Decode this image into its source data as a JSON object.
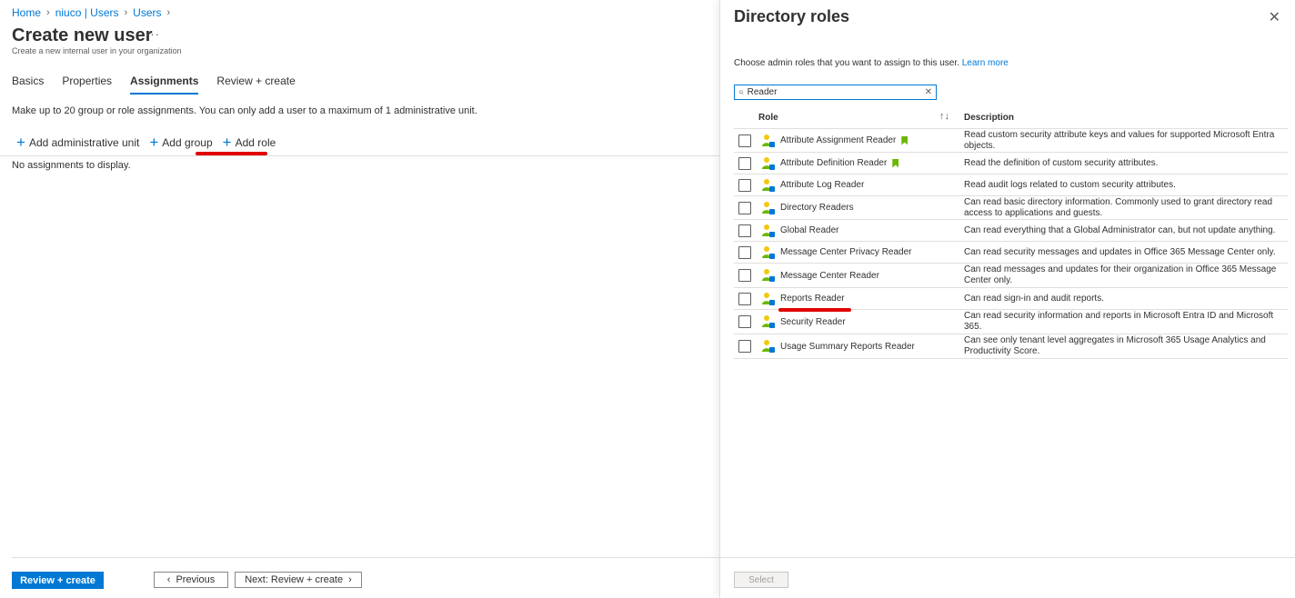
{
  "breadcrumb": [
    {
      "label": "Home"
    },
    {
      "label": "niuco | Users"
    },
    {
      "label": "Users"
    }
  ],
  "page": {
    "title": "Create new user",
    "more": "···",
    "subtitle": "Create a new internal user in your organization"
  },
  "tabs": [
    {
      "label": "Basics",
      "active": false
    },
    {
      "label": "Properties",
      "active": false
    },
    {
      "label": "Assignments",
      "active": true
    },
    {
      "label": "Review + create",
      "active": false
    }
  ],
  "info_text": "Make up to 20 group or role assignments. You can only add a user to a maximum of 1 administrative unit.",
  "toolbar": {
    "add_admin_unit": "Add administrative unit",
    "add_group": "Add group",
    "add_role": "Add role"
  },
  "no_assignments": "No assignments to display.",
  "footer": {
    "review_create": "Review + create",
    "previous": "Previous",
    "next": "Next: Review + create"
  },
  "panel": {
    "title": "Directory roles",
    "description": "Choose admin roles that you want to assign to this user.",
    "learn_more": "Learn more",
    "search_value": "Reader",
    "col_role": "Role",
    "col_description": "Description",
    "select_label": "Select",
    "roles": [
      {
        "name": "Attribute Assignment Reader",
        "bookmark": true,
        "description": "Read custom security attribute keys and values for supported Microsoft Entra objects.",
        "h": 26
      },
      {
        "name": "Attribute Definition Reader",
        "bookmark": true,
        "description": "Read the definition of custom security attributes.",
        "h": 24
      },
      {
        "name": "Attribute Log Reader",
        "bookmark": false,
        "description": "Read audit logs related to custom security attributes.",
        "h": 24
      },
      {
        "name": "Directory Readers",
        "bookmark": false,
        "description": "Can read basic directory information. Commonly used to grant directory read access to applications and guests.",
        "h": 26
      },
      {
        "name": "Global Reader",
        "bookmark": false,
        "description": "Can read everything that a Global Administrator can, but not update anything.",
        "h": 24
      },
      {
        "name": "Message Center Privacy Reader",
        "bookmark": false,
        "description": "Can read security messages and updates in Office 365 Message Center only.",
        "h": 24
      },
      {
        "name": "Message Center Reader",
        "bookmark": false,
        "description": "Can read messages and updates for their organization in Office 365 Message Center only.",
        "h": 27
      },
      {
        "name": "Reports Reader",
        "bookmark": false,
        "description": "Can read sign-in and audit reports.",
        "h": 24
      },
      {
        "name": "Security Reader",
        "bookmark": false,
        "description": "Can read security information and reports in Microsoft Entra ID and Microsoft 365.",
        "h": 27
      },
      {
        "name": "Usage Summary Reports Reader",
        "bookmark": false,
        "description": "Can see only tenant level aggregates in Microsoft 365 Usage Analytics and Productivity Score.",
        "h": 27
      }
    ]
  },
  "colors": {
    "accent": "#0078d4",
    "highlight": "#e00000",
    "bookmark": "#6bb700"
  }
}
